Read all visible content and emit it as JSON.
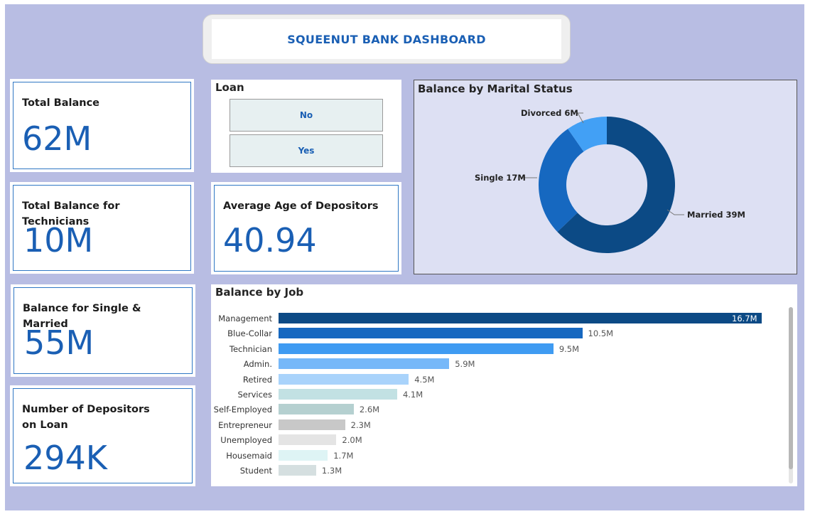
{
  "header": {
    "title": "SQUEENUT BANK DASHBOARD"
  },
  "kpis": {
    "total_balance": {
      "label": "Total Balance",
      "value": "62M"
    },
    "technicians": {
      "label": "Total Balance for Technicians",
      "value": "10M"
    },
    "single_married": {
      "label": "Balance for Single & Married",
      "value": "55M"
    },
    "depositors_on_loan": {
      "label": "Number of Depositors on Loan",
      "value": "294K"
    },
    "average_age": {
      "label": "Average Age of Depositors",
      "value": "40.94"
    }
  },
  "loan_slicer": {
    "title": "Loan",
    "options": [
      "No",
      "Yes"
    ]
  },
  "colors": {
    "background": "#b8bde3",
    "accent": "#1a5fb4",
    "married": "#0c4a85",
    "single": "#1668c0",
    "divorced": "#42a0f5"
  },
  "chart_data": [
    {
      "type": "pie",
      "title": "Balance by Marital Status",
      "categories": [
        "Married",
        "Single",
        "Divorced"
      ],
      "values": [
        39,
        17,
        6
      ],
      "unit": "M",
      "labels": [
        "Married 39M",
        "Single 17M",
        "Divorced 6M"
      ],
      "colors": [
        "#0c4a85",
        "#1668c0",
        "#42a0f5"
      ],
      "legend": "none"
    },
    {
      "type": "bar",
      "orientation": "horizontal",
      "title": "Balance by Job",
      "categories": [
        "Management",
        "Blue-Collar",
        "Technician",
        "Admin.",
        "Retired",
        "Services",
        "Self-Employed",
        "Entrepreneur",
        "Unemployed",
        "Housemaid",
        "Student"
      ],
      "values": [
        16.7,
        10.5,
        9.5,
        5.9,
        4.5,
        4.1,
        2.6,
        2.3,
        2.0,
        1.7,
        1.3
      ],
      "value_labels": [
        "16.7M",
        "10.5M",
        "9.5M",
        "5.9M",
        "4.5M",
        "4.1M",
        "2.6M",
        "2.3M",
        "2.0M",
        "1.7M",
        "1.3M"
      ],
      "colors": [
        "#0c4a85",
        "#1668c0",
        "#3f9bf2",
        "#76b8f9",
        "#a9d3fb",
        "#c2e1e3",
        "#b5d0d0",
        "#c8c8c8",
        "#e4e4e4",
        "#def4f5",
        "#d5dfe0"
      ],
      "xlim": [
        0,
        16.7
      ],
      "grid": false
    }
  ]
}
